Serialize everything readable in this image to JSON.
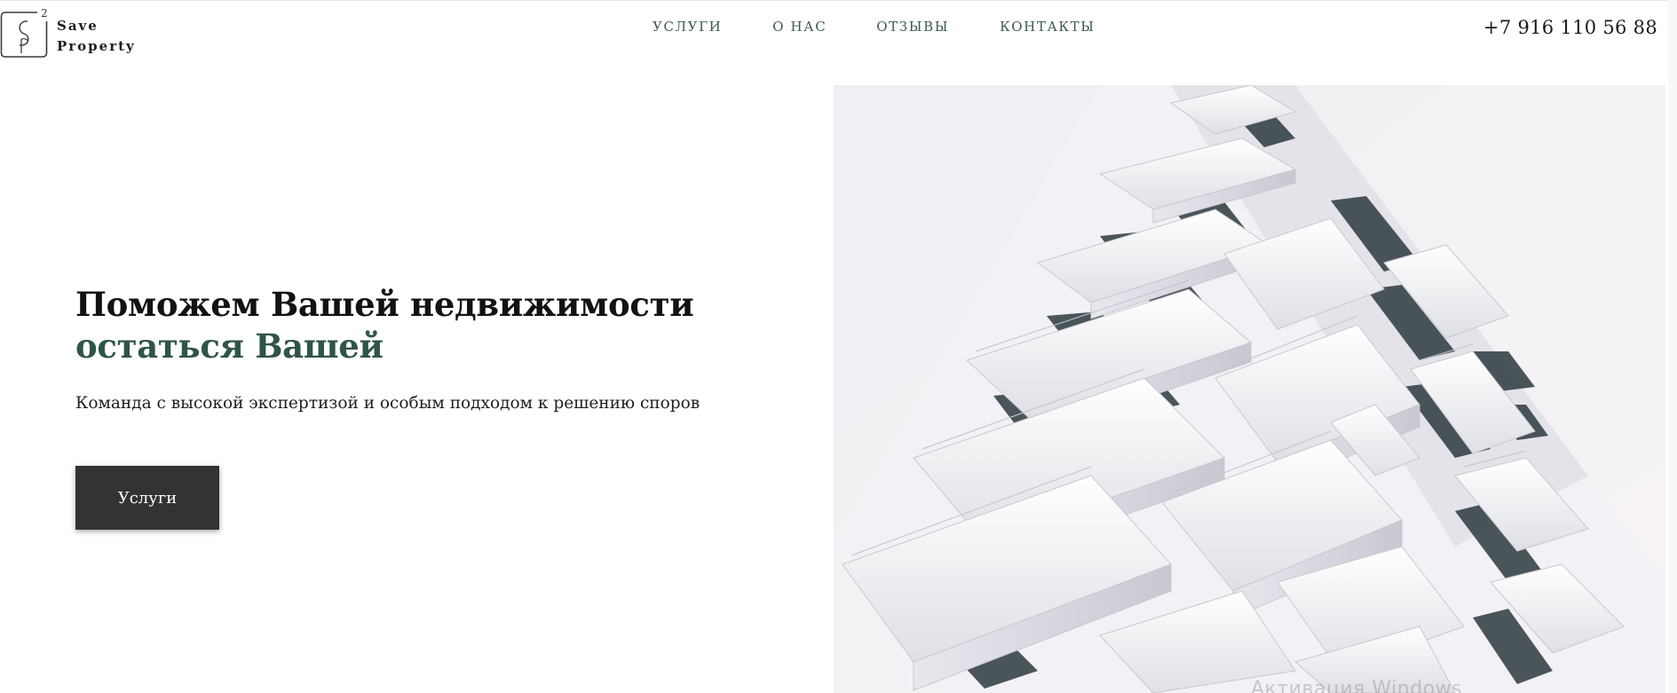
{
  "brand": {
    "logo_glyph": "S",
    "logo_superscript": "2",
    "name_line1": "Save",
    "name_line2": "Property"
  },
  "nav": {
    "items": [
      {
        "label": "УСЛУГИ"
      },
      {
        "label": "О НАС"
      },
      {
        "label": "ОТЗЫВЫ"
      },
      {
        "label": "КОНТАКТЫ"
      }
    ]
  },
  "header": {
    "phone": "+7 916 110 56 88"
  },
  "hero": {
    "headline_line1": "Поможем Вашей недвижимости",
    "headline_line2": "остаться Вашей",
    "subtitle": "Команда с высокой экспертизой и особым подходом к решению споров",
    "cta_label": "Услуги",
    "image_overlay_text": "Активация Windows"
  },
  "colors": {
    "accent_green": "#2f5545",
    "nav_green": "#3d5b4f",
    "button_dark": "#333333",
    "text_dark": "#121212"
  },
  "icons": {
    "logo": "sp-monogram-icon",
    "hero_image": "modern-apartment-building-image"
  }
}
